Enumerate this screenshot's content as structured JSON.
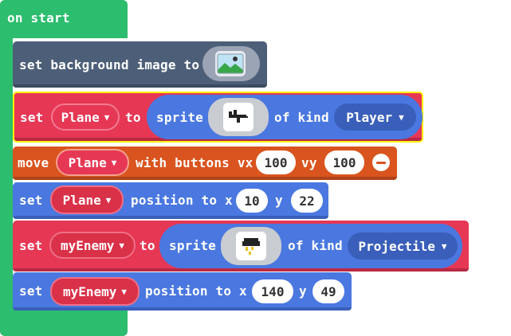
{
  "on_start": {
    "label": "on start"
  },
  "blocks": {
    "set_background": {
      "label": "set background image to",
      "image_icon": "landscape-image-icon"
    },
    "set_plane": {
      "set_label": "set",
      "variable": "Plane",
      "to_label": "to",
      "sprite_label": "sprite",
      "sprite_icon": "plane-sprite-icon",
      "kind_label": "of kind",
      "kind": "Player"
    },
    "move_plane": {
      "move_label": "move",
      "variable": "Plane",
      "buttons_label": "with buttons vx",
      "vx": "100",
      "vy_label": "vy",
      "vy": "100",
      "minus_icon": "remove-parameter-icon"
    },
    "plane_position": {
      "set_label": "set",
      "variable": "Plane",
      "position_label": "position to x",
      "x": "10",
      "y_label": "y",
      "y": "22"
    },
    "set_enemy": {
      "set_label": "set",
      "variable": "myEnemy",
      "to_label": "to",
      "sprite_label": "sprite",
      "sprite_icon": "storm-cloud-sprite-icon",
      "kind_label": "of kind",
      "kind": "Projectile"
    },
    "enemy_position": {
      "set_label": "set",
      "variable": "myEnemy",
      "position_label": "position to x",
      "x": "140",
      "y_label": "y",
      "y": "49"
    }
  },
  "colors": {
    "event_green": "#2dbd6e",
    "scene_slate": "#4d5f78",
    "sprite_red": "#e63755",
    "controller_orange": "#d9541e",
    "position_blue": "#4a78e0",
    "highlight_yellow": "#fff200"
  }
}
